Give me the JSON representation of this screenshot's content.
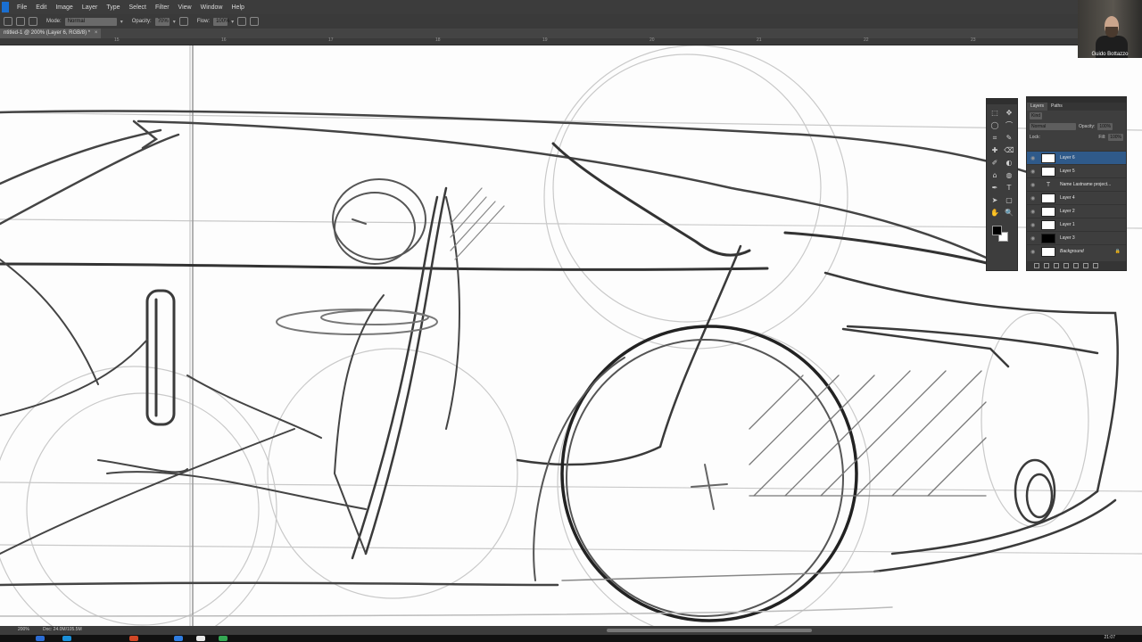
{
  "menubar": {
    "items": [
      "File",
      "Edit",
      "Image",
      "Layer",
      "Type",
      "Select",
      "Filter",
      "View",
      "Window",
      "Help"
    ]
  },
  "options": {
    "mode_label": "Mode:",
    "mode_value": "Normal",
    "opacity_label": "Opacity:",
    "opacity_value": "70%",
    "flow_label": "Flow:",
    "flow_value": "100%"
  },
  "document": {
    "tab_title": "ntitled-1 @ 200% (Layer 6, RGB/8) *",
    "close": "×"
  },
  "ruler": {
    "ticks": [
      "15",
      "16",
      "17",
      "18",
      "19",
      "20",
      "21",
      "22",
      "23"
    ]
  },
  "webcam": {
    "name": "Guido Bottazzo"
  },
  "layers_panel": {
    "tabs": [
      "Layers",
      "Paths"
    ],
    "kind_label": "Kind",
    "blend_mode": "Normal",
    "opacity_label": "Opacity:",
    "opacity_value": "100%",
    "lock_label": "Lock:",
    "fill_label": "Fill:",
    "fill_value": "100%",
    "layers": [
      {
        "name": "Layer 6",
        "thumb": "white",
        "selected": true
      },
      {
        "name": "Layer 5",
        "thumb": "white",
        "selected": false
      },
      {
        "name": "Name Lastname project...",
        "thumb": "text",
        "selected": false
      },
      {
        "name": "Layer 4",
        "thumb": "white",
        "selected": false
      },
      {
        "name": "Layer 2",
        "thumb": "white",
        "selected": false
      },
      {
        "name": "Layer 1",
        "thumb": "white",
        "selected": false
      },
      {
        "name": "Layer 3",
        "thumb": "black",
        "selected": false
      },
      {
        "name": "Background",
        "thumb": "white",
        "selected": false,
        "locked": true
      }
    ]
  },
  "tools": {
    "glyphs": [
      "⬚",
      "✥",
      "◯",
      "⌒",
      "⌗",
      "✎",
      "✚",
      "⌫",
      "✐",
      "◐",
      "⌂",
      "◍",
      "✒",
      "T",
      "➤",
      "▢",
      "✋",
      "🔍"
    ]
  },
  "statusbar": {
    "zoom": "200%",
    "doc": "Doc: 24.0M/105.5M",
    "clock": "21:07"
  },
  "colors": {
    "canvas": "#fdfdfd",
    "chrome_dark": "#3c3c3c",
    "selected_layer": "#2f5a8a"
  }
}
